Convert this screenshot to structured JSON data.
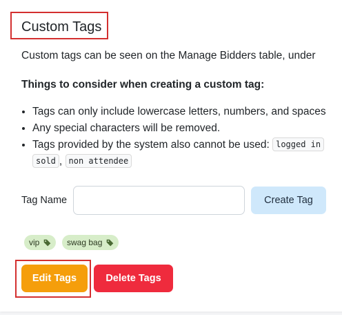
{
  "section": {
    "title": "Custom Tags",
    "description": "Custom tags can be seen on the Manage Bidders table, under",
    "considerations_heading": "Things to consider when creating a custom tag:",
    "rules": [
      "Tags can only include lowercase letters, numbers, and spaces",
      "Any special characters will be removed.",
      "Tags provided by the system also cannot be used:"
    ],
    "system_tags": [
      "logged in",
      "sold",
      "non attendee"
    ],
    "separator": ","
  },
  "form": {
    "tag_name_label": "Tag Name",
    "tag_name_value": "",
    "tag_name_placeholder": "",
    "create_button": "Create Tag"
  },
  "tags": [
    {
      "label": "vip",
      "icon": "tag-icon"
    },
    {
      "label": "swag bag",
      "icon": "tag-icon"
    }
  ],
  "actions": {
    "edit_button": "Edit Tags",
    "delete_button": "Delete Tags"
  },
  "colors": {
    "edit": "#f59e0b",
    "delete": "#ef2b3d",
    "create": "#cfe8fb",
    "chip": "#d7edc9",
    "highlight": "#d32f2f"
  }
}
